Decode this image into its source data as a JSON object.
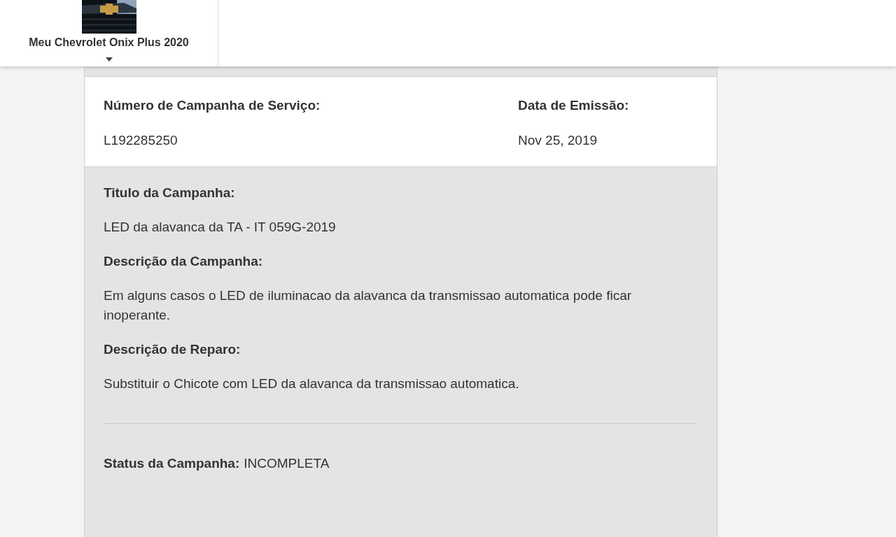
{
  "vehicle_selector": {
    "label": "Meu Chevrolet Onix Plus 2020"
  },
  "campaign": {
    "number_label": "Número de Campanha de Serviço:",
    "number": "L192285250",
    "date_label": "Data de Emissão:",
    "date": "Nov 25, 2019",
    "sections": [
      {
        "heading": "Titulo da Campanha:",
        "text": "LED da alavanca da TA - IT 059G-2019"
      },
      {
        "heading": "Descrição da Campanha:",
        "text": "Em alguns casos o LED de iluminacao da alavanca da transmissao automatica pode ficar inoperante."
      },
      {
        "heading": "Descrição de Reparo:",
        "text": "Substituir o Chicote com LED da alavanca da transmissao automatica."
      }
    ],
    "status_label": "Status da Campanha:",
    "status": "INCOMPLETA"
  }
}
